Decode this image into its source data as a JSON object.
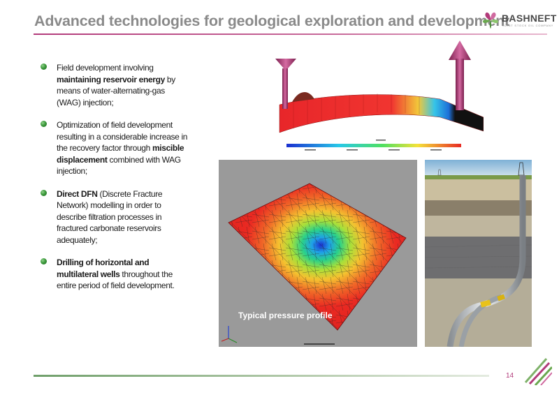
{
  "header": {
    "title": "Advanced technologies for geological exploration and development"
  },
  "logo": {
    "name": "BASHNEFT",
    "subtitle": "JOINT STOCK OIL COMPANY",
    "icon": "bashneft-flower-icon",
    "colors": {
      "green": "#6aa84f",
      "magenta": "#b23a7a"
    }
  },
  "bullets": [
    {
      "pre": "Field development involving ",
      "bold": "maintaining reservoir energy",
      "post": " by means of water-alternating-gas (WAG) injection;"
    },
    {
      "pre": "Optimization of field development resulting in a considerable increase in the recovery factor through ",
      "bold": "miscible displacement",
      "post": " combined with WAG injection;"
    },
    {
      "pre": "",
      "bold": "Direct DFN",
      "post": " (Discrete Fracture Network) modelling in order to describe filtration processes in fractured carbonate reservoirs adequately;"
    },
    {
      "pre": "",
      "bold": "Drilling of horizontal and multilateral wells",
      "post": " throughout the entire period of field development."
    }
  ],
  "figures": {
    "map_caption": "Typical pressure profile"
  },
  "footer": {
    "page_number": "14"
  },
  "colors": {
    "title": "#8a8a8a",
    "accent_magenta": "#b23a7a",
    "accent_green": "#6f9f6a"
  }
}
